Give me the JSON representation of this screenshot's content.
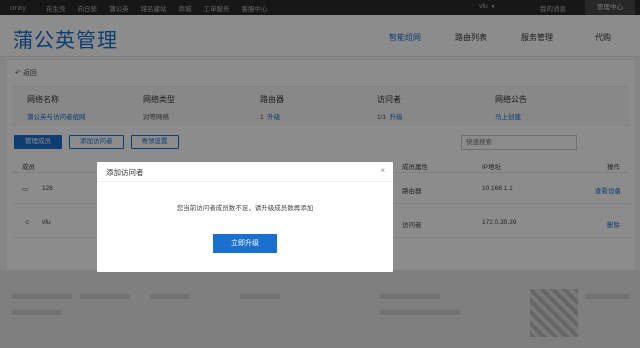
{
  "topbar": {
    "logo": "oray",
    "nav": [
      "花生壳",
      "向日葵",
      "蒲公英",
      "域名建站",
      "商城",
      "工单服务",
      "客服中心"
    ],
    "user": "vfu",
    "messages": "我的消息",
    "management": "管理中心"
  },
  "header": {
    "title": "蒲公英管理",
    "tabs": [
      "智能组网",
      "路由列表",
      "服务管理",
      "代购"
    ],
    "active_tab": "智能组网"
  },
  "main": {
    "back": "返回",
    "info": {
      "network_name_label": "网络名称",
      "network_name_value": "蒲公英与访问者组网",
      "network_type_label": "网络类型",
      "network_type_value": "对等网络",
      "router_label": "路由器",
      "router_count": "1",
      "router_link": "升级",
      "visitor_label": "访问者",
      "visitor_count": "1/1",
      "visitor_link": "升级",
      "announcement_label": "网络公告",
      "announcement_link": "马上创建"
    },
    "buttons": {
      "manage_members": "管理成员",
      "add_visitor": "添加访问者",
      "owner_settings": "寄领设置"
    },
    "search_placeholder": "快速搜索",
    "table": {
      "headers": [
        "成员",
        "成员属性",
        "IP地址",
        "操作"
      ],
      "rows": [
        {
          "name": "126",
          "attribute": "路由器",
          "ip": "10.168.1.1",
          "action": "查看设备"
        },
        {
          "name": "vfu",
          "attribute": "访问者",
          "ip": "172.0.39.39",
          "action": "删除"
        }
      ]
    }
  },
  "modal": {
    "title": "添加访问者",
    "close": "×",
    "message": "您当前访问者成员数不足，请升级成员数再添加",
    "upgrade_button": "立即升级"
  },
  "colors": {
    "accent": "#1a6fcf",
    "topbar": "#2b2b2b"
  }
}
